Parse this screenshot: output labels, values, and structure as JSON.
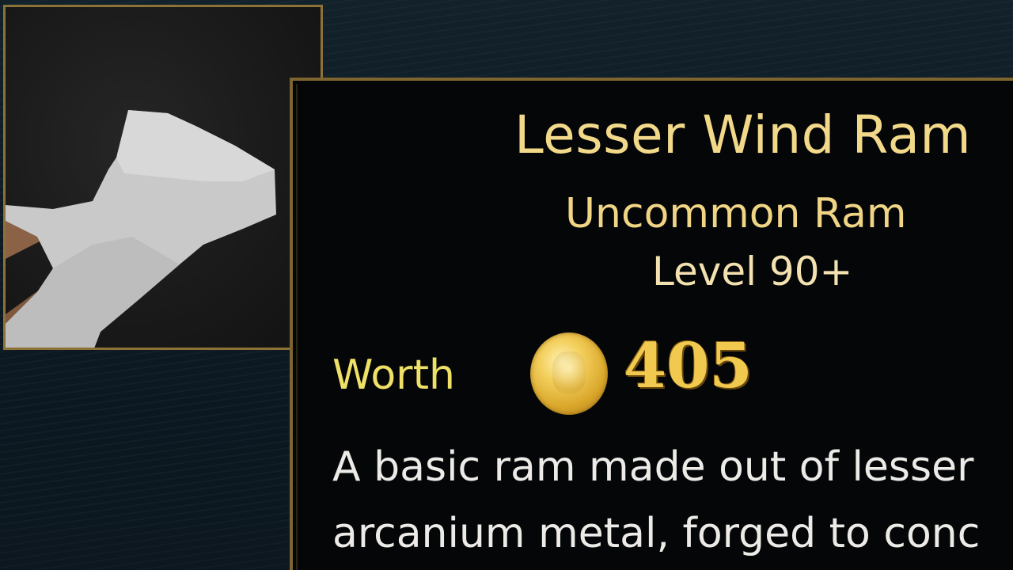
{
  "item": {
    "name": "Lesser Wind Ram",
    "rarity_type": "Uncommon Ram",
    "level_requirement": "Level 90+",
    "worth_label": "Worth",
    "worth_value": "405",
    "description_lines": [
      "A basic ram made out of lesser",
      "arcanium metal, forged to conc"
    ],
    "icon": "ram-item-icon",
    "currency_icon": "gold-coin-icon"
  },
  "colors": {
    "border_gold": "#8c7237",
    "title_gold": "#f2d98a",
    "worth_yellow": "#efe066",
    "coin_gold": "#f1c94e",
    "panel_bg": "#050608"
  }
}
